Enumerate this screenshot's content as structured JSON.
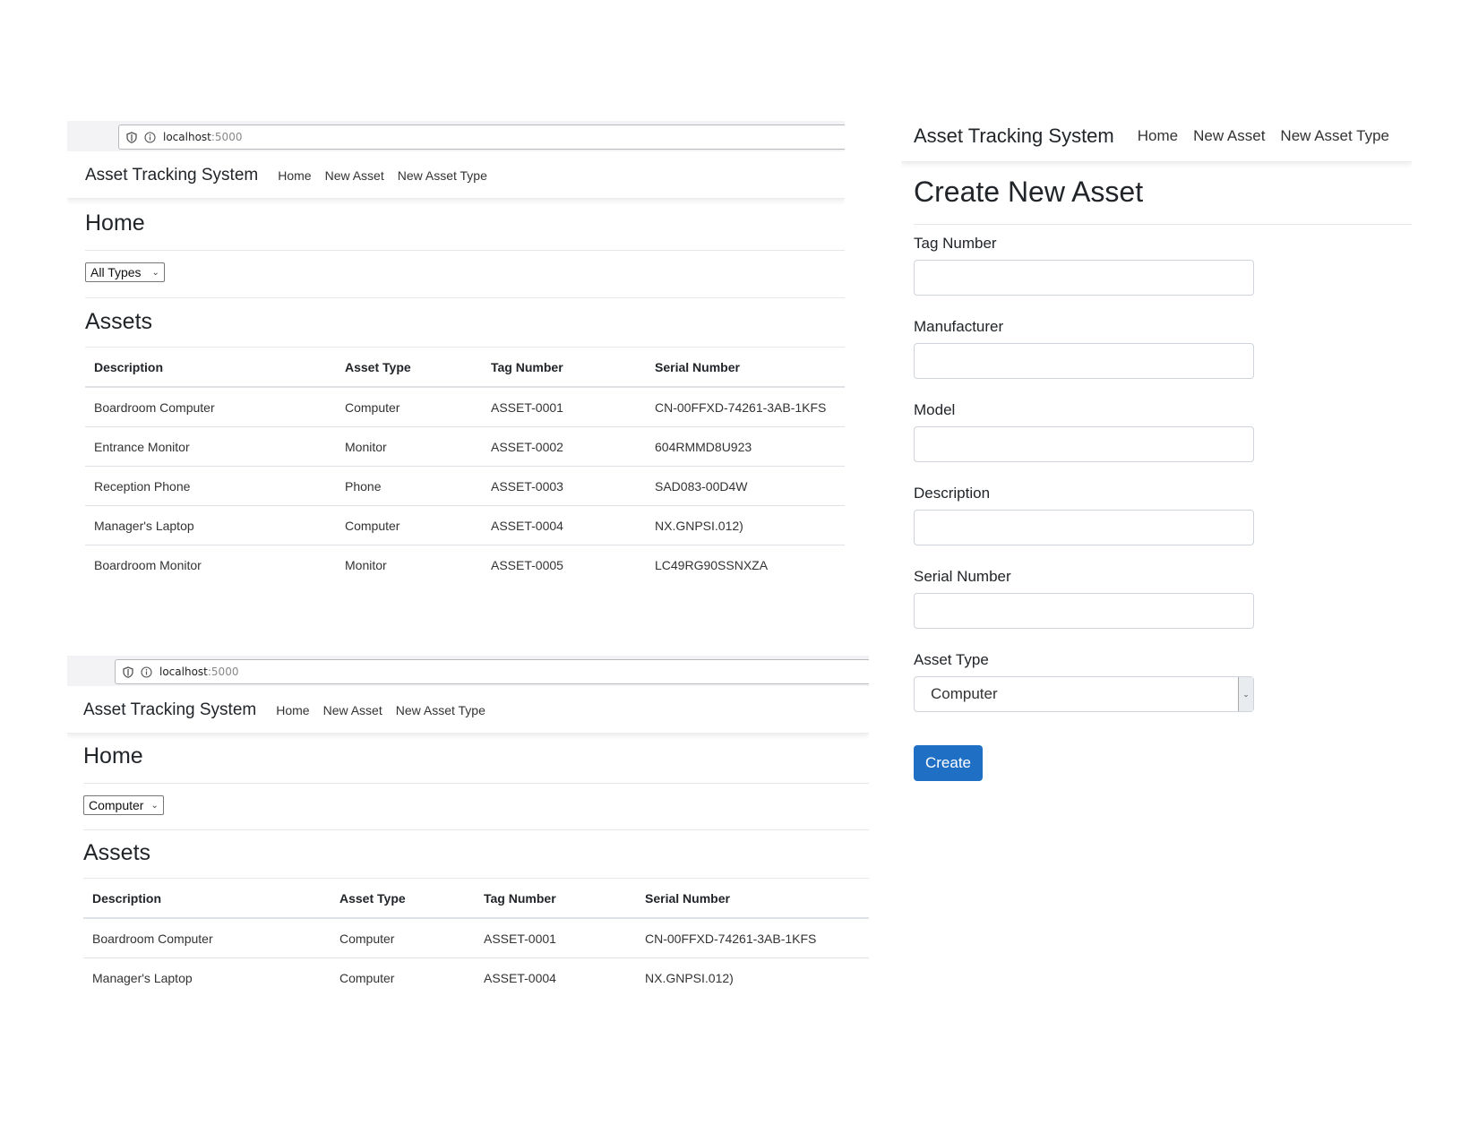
{
  "browser": {
    "url_host": "localhost",
    "url_port": ":5000"
  },
  "app": {
    "brand": "Asset Tracking System",
    "nav": [
      "Home",
      "New Asset",
      "New Asset Type"
    ]
  },
  "home_all": {
    "page_title": "Home",
    "filter_value": "All Types",
    "section_title": "Assets",
    "columns": [
      "Description",
      "Asset Type",
      "Tag Number",
      "Serial Number"
    ],
    "rows": [
      [
        "Boardroom Computer",
        "Computer",
        "ASSET-0001",
        "CN-00FFXD-74261-3AB-1KFS"
      ],
      [
        "Entrance Monitor",
        "Monitor",
        "ASSET-0002",
        "604RMMD8U923"
      ],
      [
        "Reception Phone",
        "Phone",
        "ASSET-0003",
        "SAD083-00D4W"
      ],
      [
        "Manager's Laptop",
        "Computer",
        "ASSET-0004",
        "NX.GNPSI.012)"
      ],
      [
        "Boardroom Monitor",
        "Monitor",
        "ASSET-0005",
        "LC49RG90SSNXZA"
      ]
    ]
  },
  "home_computer": {
    "page_title": "Home",
    "filter_value": "Computer",
    "section_title": "Assets",
    "columns": [
      "Description",
      "Asset Type",
      "Tag Number",
      "Serial Number"
    ],
    "rows": [
      [
        "Boardroom Computer",
        "Computer",
        "ASSET-0001",
        "CN-00FFXD-74261-3AB-1KFS"
      ],
      [
        "Manager's Laptop",
        "Computer",
        "ASSET-0004",
        "NX.GNPSI.012)"
      ]
    ]
  },
  "create_form": {
    "title": "Create New Asset",
    "fields": [
      {
        "label": "Tag Number",
        "value": ""
      },
      {
        "label": "Manufacturer",
        "value": ""
      },
      {
        "label": "Model",
        "value": ""
      },
      {
        "label": "Description",
        "value": ""
      },
      {
        "label": "Serial Number",
        "value": ""
      }
    ],
    "asset_type_label": "Asset Type",
    "asset_type_value": "Computer",
    "submit_label": "Create"
  },
  "colors": {
    "primary_button": "#1f6fc5",
    "text": "#212529",
    "divider": "#dee2e6"
  },
  "icons": [
    "shield-icon",
    "info-icon",
    "chevron-down-icon"
  ]
}
